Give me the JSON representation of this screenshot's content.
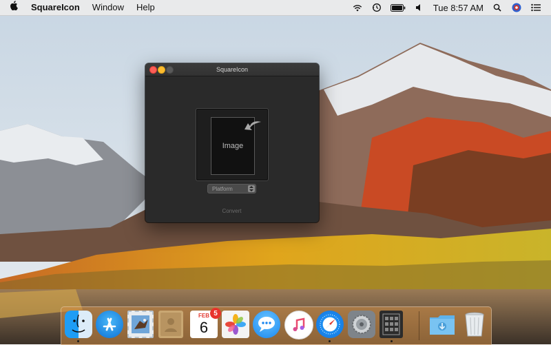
{
  "menubar": {
    "apple_icon": "apple-icon",
    "app_name": "SquareIcon",
    "menus": [
      "Window",
      "Help"
    ],
    "status_icons": [
      "wifi-icon",
      "time-machine-icon",
      "battery-icon",
      "volume-icon"
    ],
    "clock": "Tue 8:57 AM",
    "right_icons": [
      "spotlight-icon",
      "user-icon",
      "notification-center-icon"
    ]
  },
  "window": {
    "title": "SquareIcon",
    "drop_label": "Image",
    "platform_select": {
      "value": "Platform"
    },
    "convert_label": "Convert"
  },
  "dock": {
    "apps": [
      {
        "name": "finder",
        "icon": "finder-icon",
        "running": true
      },
      {
        "name": "app-store",
        "icon": "app-store-icon",
        "running": false
      },
      {
        "name": "mail-eagle",
        "icon": "mail-icon",
        "running": false
      },
      {
        "name": "contacts",
        "icon": "contacts-icon",
        "running": false
      },
      {
        "name": "calendar",
        "icon": "calendar-icon",
        "running": false,
        "month": "FEB",
        "day": "6",
        "badge": "5"
      },
      {
        "name": "photos",
        "icon": "photos-icon",
        "running": false
      },
      {
        "name": "messages",
        "icon": "messages-icon",
        "running": false
      },
      {
        "name": "itunes",
        "icon": "itunes-icon",
        "running": false
      },
      {
        "name": "safari",
        "icon": "safari-icon",
        "running": true
      },
      {
        "name": "system-preferences",
        "icon": "system-preferences-icon",
        "running": false
      },
      {
        "name": "squareicon",
        "icon": "squareicon-app-icon",
        "running": true
      }
    ],
    "folders": [
      {
        "name": "downloads",
        "icon": "downloads-folder-icon"
      },
      {
        "name": "trash",
        "icon": "trash-icon"
      }
    ]
  },
  "colors": {
    "window_bg": "#2a2a2a",
    "close": "#fc5f57",
    "minimize": "#fdbc2e",
    "badge": "#e8332c"
  }
}
